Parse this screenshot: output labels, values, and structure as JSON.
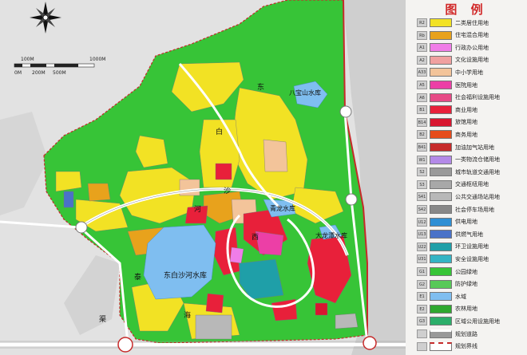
{
  "legend": {
    "title": "图 例",
    "items": [
      {
        "code": "R2",
        "label": "二类居住用地",
        "color": "#f2e224"
      },
      {
        "code": "Rb",
        "label": "住宅混合用地",
        "color": "#e8a21c"
      },
      {
        "code": "A1",
        "label": "行政办公用地",
        "color": "#f07de8"
      },
      {
        "code": "A2",
        "label": "文化设施用地",
        "color": "#f0a0a0"
      },
      {
        "code": "A33",
        "label": "中小学用地",
        "color": "#f3c49a"
      },
      {
        "code": "A5",
        "label": "医院用地",
        "color": "#ec3fa6"
      },
      {
        "code": "A6",
        "label": "社会福利设施用地",
        "color": "#e74a86"
      },
      {
        "code": "B1",
        "label": "商业用地",
        "color": "#e8203a"
      },
      {
        "code": "B14",
        "label": "旅馆用地",
        "color": "#d81630"
      },
      {
        "code": "B2",
        "label": "商务用地",
        "color": "#e64c1c"
      },
      {
        "code": "B41",
        "label": "加油加气站用地",
        "color": "#c62a2a"
      },
      {
        "code": "W1",
        "label": "一类物流仓储用地",
        "color": "#b48ae8"
      },
      {
        "code": "S2",
        "label": "城市轨道交通用地",
        "color": "#9a9a9a"
      },
      {
        "code": "S3",
        "label": "交通枢纽用地",
        "color": "#a8a8a8"
      },
      {
        "code": "S41",
        "label": "公共交通场站用地",
        "color": "#b8b8b8"
      },
      {
        "code": "S42",
        "label": "社会停车场用地",
        "color": "#888888"
      },
      {
        "code": "U12",
        "label": "供电用地",
        "color": "#2f8fd4"
      },
      {
        "code": "U13",
        "label": "供燃气用地",
        "color": "#4a72c8"
      },
      {
        "code": "U22",
        "label": "环卫设施用地",
        "color": "#1f9fa8"
      },
      {
        "code": "U31",
        "label": "安全设施用地",
        "color": "#34b4c4"
      },
      {
        "code": "G1",
        "label": "公园绿地",
        "color": "#37c437"
      },
      {
        "code": "G2",
        "label": "防护绿地",
        "color": "#58c958"
      },
      {
        "code": "E1",
        "label": "水域",
        "color": "#7fbef0"
      },
      {
        "code": "E2",
        "label": "农林用地",
        "color": "#2fa82f"
      },
      {
        "code": "G3",
        "label": "区域公用设施用地",
        "color": "#2cae6a"
      },
      {
        "code": "",
        "label": "规划道路",
        "color": "#ffffff"
      },
      {
        "code": "",
        "label": "规划界线",
        "color": "#ffffff"
      }
    ]
  },
  "scale": {
    "labels": [
      "100M",
      "1000M",
      "0M",
      "200M",
      "500M"
    ]
  },
  "map_labels": {
    "reservoir_a": "八宝山水库",
    "reservoir_b": "青龙水库",
    "reservoir_c": "大龙潭水库",
    "reservoir_d": "东白沙河水库",
    "char_dong": "东",
    "char_bai": "白",
    "char_sha": "沙",
    "char_he": "河",
    "char_xi": "西",
    "char_qu": "渠",
    "char_tai": "泰",
    "char_hai": "海"
  },
  "colors": {
    "green": "#37c437",
    "yellow": "#f2e224",
    "red": "#e8203a",
    "water": "#7fbef0",
    "boundary": "#c62a2a"
  }
}
